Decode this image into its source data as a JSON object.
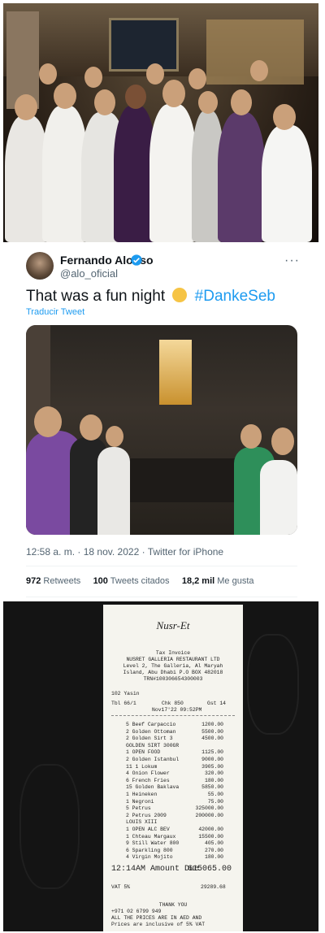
{
  "tweet": {
    "author_name": "Fernando Alonso",
    "handle": "@alo_oficial",
    "more_label": "···",
    "text": "That was a fun night",
    "hashtag": "#DankeSeb",
    "translate_label": "Traducir Tweet",
    "time": "12:58 a. m.",
    "date": "18 nov. 2022",
    "source": "Twitter for iPhone",
    "retweets_count": "972",
    "retweets_label": "Retweets",
    "quotes_count": "100",
    "quotes_label": "Tweets citados",
    "likes_count": "18,2 mil",
    "likes_label": "Me gusta",
    "verified_color": "#1d9bf0"
  },
  "receipt": {
    "logo": "Nusr-Et",
    "header_lines": [
      "Tax Invoice",
      "NUSRET GALLERIA RESTAURANT LTD",
      "Level 2, The Galleria, Al Maryah",
      "Island, Abu Dhabi P.O BOX 482018",
      "TRN#100306654300003"
    ],
    "table": "102 Yasin",
    "tbl": "Tbl 66/1",
    "chk": "Chk 850",
    "gst": "Gst 14",
    "date": "Nov17'22 09:52PM",
    "items": [
      {
        "desc": "5 Beef Carpaccio",
        "price": "1200.00"
      },
      {
        "desc": "2 Golden Ottoman",
        "price": "5500.00"
      },
      {
        "desc": "2 Golden Sirt 3",
        "price": "4500.00"
      },
      {
        "desc": "GOLDEN SIRT 300GR",
        "price": ""
      },
      {
        "desc": "1 OPEN FOOD",
        "price": "1125.00"
      },
      {
        "desc": "2 Golden Istanbul",
        "price": "9000.00"
      },
      {
        "desc": "11 1 Lokum",
        "price": "3905.00"
      },
      {
        "desc": "4 Onion Flower",
        "price": "320.00"
      },
      {
        "desc": "6 French Fries",
        "price": "180.00"
      },
      {
        "desc": "15 Golden Baklava",
        "price": "5850.00"
      },
      {
        "desc": "1 Heineken",
        "price": "55.00"
      },
      {
        "desc": "1 Negroni",
        "price": "75.00"
      },
      {
        "desc": "5 Petrus",
        "price": "325000.00"
      },
      {
        "desc": "2 Petrus 2009",
        "price": "200000.00"
      },
      {
        "desc": "LOUIS XIII",
        "price": ""
      },
      {
        "desc": "1 OPEN ALC BEV",
        "price": "42000.00"
      },
      {
        "desc": "1 Chteau Margaux",
        "price": "15500.00"
      },
      {
        "desc": "9 Still Water 800",
        "price": "405.00"
      },
      {
        "desc": "6 Sparkling 800",
        "price": "270.00"
      },
      {
        "desc": "4 Virgin Mojito",
        "price": "180.00"
      }
    ],
    "amount_label": "12:14AM Amount Due",
    "amount_due": "615065.00",
    "vat_label": "VAT 5%",
    "vat_value": "29289.68",
    "thanks": "THANK YOU",
    "phone": "+971 02 6799 949",
    "footer1": "ALL THE PRICES ARE IN AED AND",
    "footer2": "Prices are inclusive of 5% VAT"
  }
}
